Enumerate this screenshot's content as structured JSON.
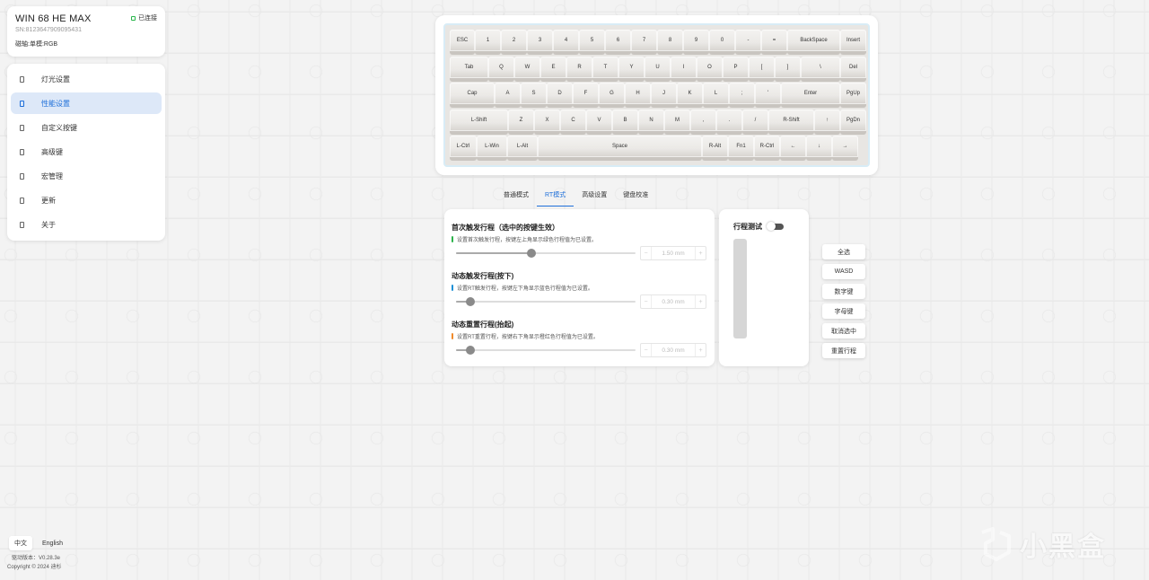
{
  "device": {
    "name": "WIN 68 HE MAX",
    "sn": "SN:8123647909095431",
    "axis": "磁轴:单模:RGB",
    "status": "已连接",
    "status_color": "#27b54a"
  },
  "menu": {
    "items": [
      {
        "label": "灯光设置",
        "icon": "menu-item-icon"
      },
      {
        "label": "性能设置",
        "icon": "menu-item-icon"
      },
      {
        "label": "自定义按键",
        "icon": "menu-item-icon"
      },
      {
        "label": "高级键",
        "icon": "menu-item-icon"
      },
      {
        "label": "宏管理",
        "icon": "menu-item-icon"
      },
      {
        "label": "更新",
        "icon": "menu-item-icon"
      },
      {
        "label": "关于",
        "icon": "menu-item-icon"
      }
    ],
    "active_index": 1
  },
  "keyboard": {
    "rows": [
      [
        "ESC",
        "1",
        "2",
        "3",
        "4",
        "5",
        "6",
        "7",
        "8",
        "9",
        "0",
        "-",
        "=",
        "BackSpace",
        "Insert"
      ],
      [
        "Tab",
        "Q",
        "W",
        "E",
        "R",
        "T",
        "Y",
        "U",
        "I",
        "O",
        "P",
        "[",
        "]",
        "\\",
        "Del"
      ],
      [
        "Cap",
        "A",
        "S",
        "D",
        "F",
        "G",
        "H",
        "J",
        "K",
        "L",
        ";",
        "'",
        "Enter",
        "PgUp"
      ],
      [
        "L-Shift",
        "Z",
        "X",
        "C",
        "V",
        "B",
        "N",
        "M",
        ",",
        ".",
        "/",
        "R-Shift",
        "↑",
        "PgDn"
      ],
      [
        "L-Ctrl",
        "L-Win",
        "L-Alt",
        "Space",
        "R-Alt",
        "Fn1",
        "R-Ctrl",
        "←",
        "↓",
        "→"
      ]
    ]
  },
  "tabs": {
    "items": [
      "普通模式",
      "RT模式",
      "高级设置",
      "键盘校准"
    ],
    "active_index": 1
  },
  "settings": {
    "sections": [
      {
        "title": "首次触发行程（选中的按键生效）",
        "desc": "设置首次触发行程，按键左上角显示绿色行程值为已设置。",
        "bar_color": "#2bb34a",
        "value": "1.50",
        "unit": "mm",
        "fraction": 0.42
      },
      {
        "title": "动态触发行程(按下)",
        "desc": "设置RT触发行程，按键左下角显示蓝色行程值为已设置。",
        "bar_color": "#1e90d6",
        "value": "0.30",
        "unit": "mm",
        "fraction": 0.08
      },
      {
        "title": "动态重置行程(抬起)",
        "desc": "设置RT重置行程，按键右下角显示橙红色行程值为已设置。",
        "bar_color": "#f08a2a",
        "value": "0.30",
        "unit": "mm",
        "fraction": 0.08
      }
    ]
  },
  "travel": {
    "title": "行程测试",
    "toggle_on": false
  },
  "quick_buttons": [
    "全选",
    "WASD",
    "数字键",
    "字母键",
    "取消选中",
    "重置行程"
  ],
  "language": {
    "options": [
      "中文",
      "English"
    ],
    "active": "中文"
  },
  "footer": {
    "version": "驱动版本：V0.28.3e",
    "copyright": "Copyright © 2024 迪杉"
  },
  "watermark": {
    "text": "小黑盒"
  }
}
